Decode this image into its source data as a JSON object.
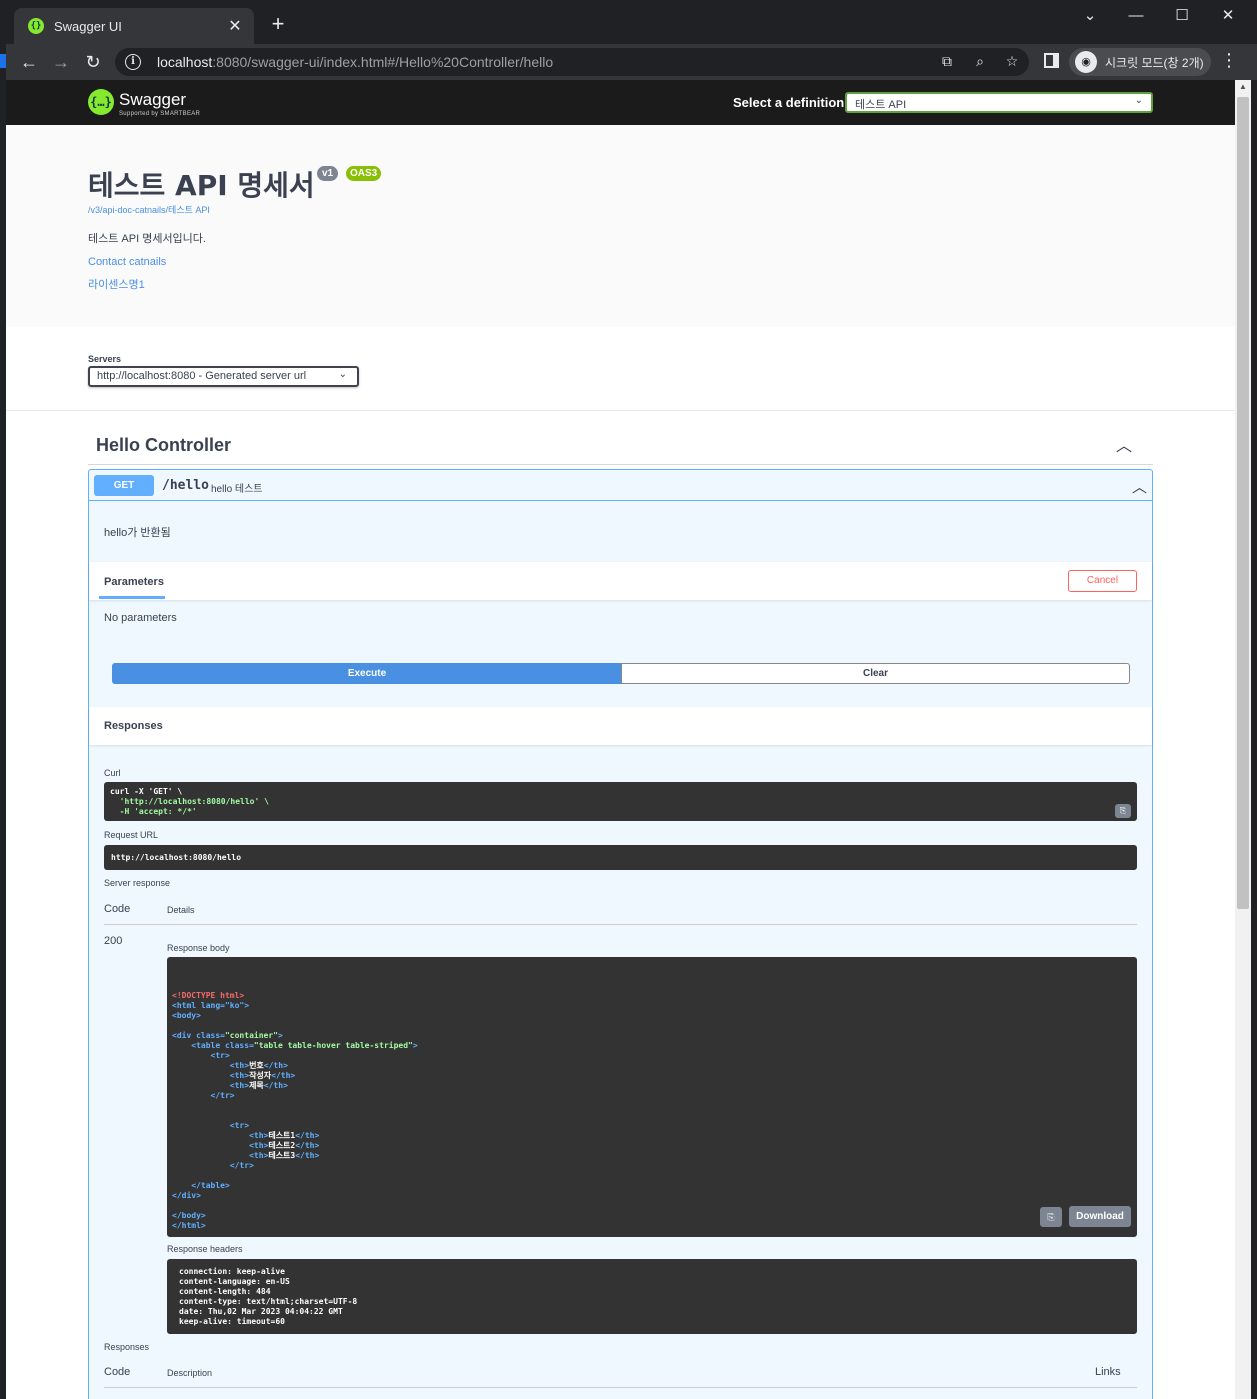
{
  "browser": {
    "tab_title": "Swagger UI",
    "url_host": "localhost",
    "url_rest": ":8080/swagger-ui/index.html#/Hello%20Controller/hello",
    "incognito_label": "시크릿 모드(창 2개)"
  },
  "topbar": {
    "logo_name": "Swagger",
    "logo_sub": "Supported by SMARTBEAR",
    "definition_label": "Select a definition",
    "definition_value": "테스트 API"
  },
  "info": {
    "title": "테스트 API 명세서",
    "version_badge": "v1",
    "oas_badge": "OAS3",
    "doc_link": "/v3/api-doc-catnails/테스트 API",
    "description": "테스트 API 명세서입니다.",
    "contact": "Contact catnails",
    "license": "라이센스명1"
  },
  "servers": {
    "label": "Servers",
    "selected": "http://localhost:8080 - Generated server url"
  },
  "tag": {
    "title": "Hello Controller"
  },
  "operation": {
    "method": "GET",
    "path": "/hello",
    "summary": "hello 테스트",
    "description": "hello가 반환됨",
    "params_tab": "Parameters",
    "cancel_label": "Cancel",
    "no_params": "No parameters",
    "execute_label": "Execute",
    "clear_label": "Clear",
    "responses_title": "Responses",
    "curl_label": "Curl",
    "curl_lines": [
      "curl -X 'GET' \\",
      "  'http://localhost:8080/hello' \\",
      "  -H 'accept: */*'"
    ],
    "request_url_label": "Request URL",
    "request_url": "http://localhost:8080/hello",
    "server_response_label": "Server response",
    "col_code": "Code",
    "col_details": "Details",
    "status_code": "200",
    "response_body_label": "Response body",
    "download_label": "Download",
    "response_headers_label": "Response headers",
    "response_headers": [
      "connection: keep-alive",
      "content-language: en-US",
      "content-length: 484",
      "content-type: text/html;charset=UTF-8",
      "date: Thu,02 Mar 2023 04:04:22 GMT",
      "keep-alive: timeout=60"
    ],
    "responses2_label": "Responses",
    "col_description": "Description",
    "col_links": "Links"
  },
  "response_body": {
    "doctype": "<!DOCTYPE html>",
    "html_open": "<html lang=\"ko\">",
    "body_open": "<body>",
    "div_open_tag": "<div class=",
    "div_class": "\"container\"",
    "div_close_bracket": ">",
    "table_open_tag": "<table class=",
    "table_class": "\"table table-hover table-striped\"",
    "table_close_bracket": ">",
    "tr_open": "<tr>",
    "th_open": "<th>",
    "th_close": "</th>",
    "tr_close": "</tr>",
    "headers": [
      "번호",
      "작성자",
      "제목"
    ],
    "cells": [
      "테스트1",
      "테스트2",
      "테스트3"
    ],
    "table_close": "</table>",
    "div_close": "</div>",
    "body_close": "</body>",
    "html_close": "</html>"
  }
}
